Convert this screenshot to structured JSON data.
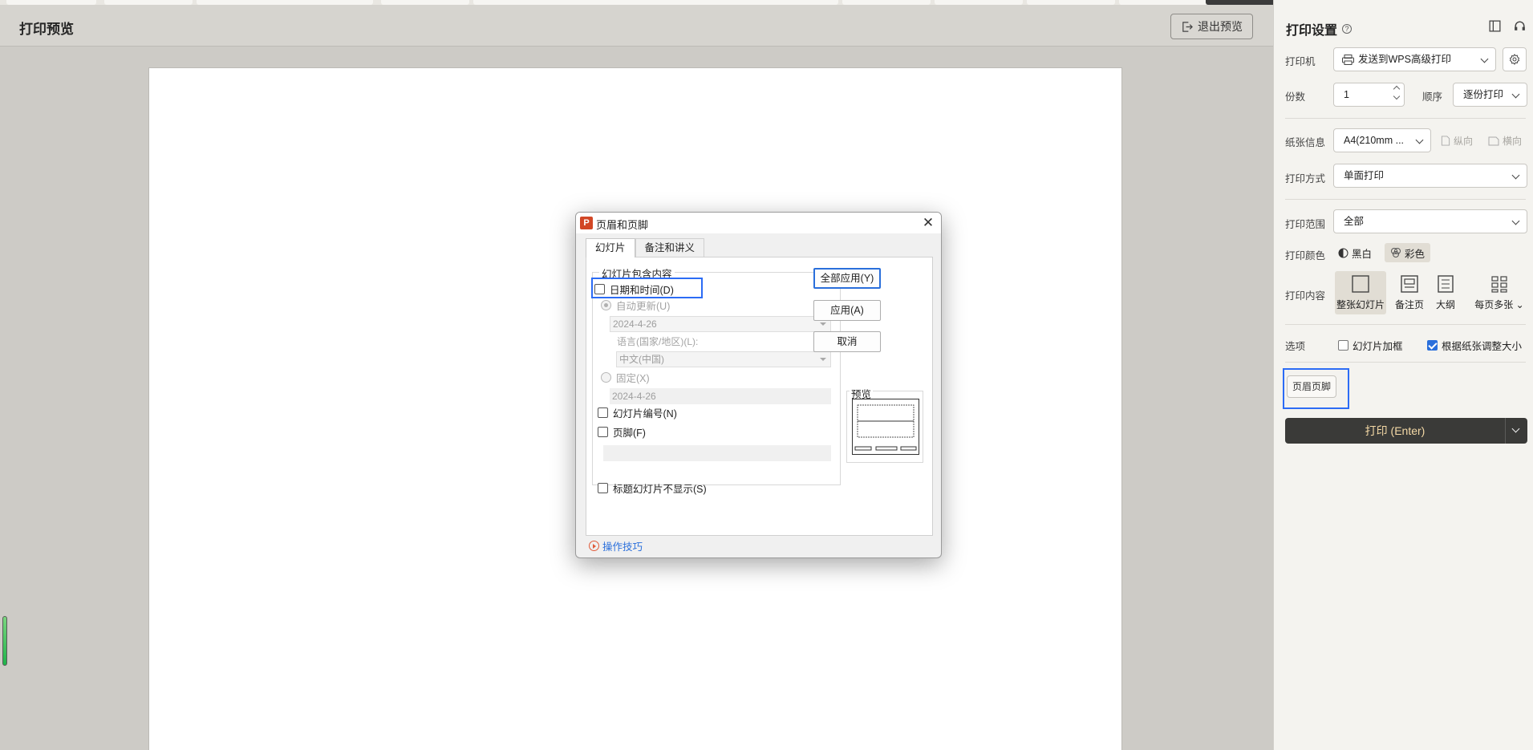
{
  "preview": {
    "title": "打印预览",
    "exit_label": "退出预览"
  },
  "dialog": {
    "title": "页眉和页脚",
    "app_icon": "P",
    "tabs": [
      "幻灯片",
      "备注和讲义"
    ],
    "group_label": "幻灯片包含内容",
    "date_time_label": "日期和时间(D)",
    "auto_update_label": "自动更新(U)",
    "auto_date_value": "2024-4-26",
    "language_label": "语言(国家/地区)(L):",
    "language_value": "中文(中国)",
    "fixed_label": "固定(X)",
    "fixed_date_value": "2024-4-26",
    "slide_number_label": "幻灯片编号(N)",
    "footer_label": "页脚(F)",
    "hide_title_label": "标题幻灯片不显示(S)",
    "apply_all_label": "全部应用(Y)",
    "apply_label": "应用(A)",
    "cancel_label": "取消",
    "preview_label": "预览",
    "tips_label": "操作技巧"
  },
  "panel": {
    "title": "打印设置",
    "printer_label": "打印机",
    "printer_value": "发送到WPS高级打印",
    "copies_label": "份数",
    "copies_value": "1",
    "order_label": "顺序",
    "order_value": "逐份打印",
    "paper_label": "纸张信息",
    "paper_value": "A4(210mm ...",
    "portrait_label": "纵向",
    "landscape_label": "横向",
    "mode_label": "打印方式",
    "mode_value": "单面打印",
    "range_label": "打印范围",
    "range_value": "全部",
    "color_label": "打印颜色",
    "color_bw": "黑白",
    "color_color": "彩色",
    "content_label": "打印内容",
    "content_options": [
      "整张幻灯片",
      "备注页",
      "大纲",
      "每页多张"
    ],
    "options_label": "选项",
    "option_frame": "幻灯片加框",
    "option_fit": "根据纸张调整大小",
    "header_footer_btn": "页眉页脚",
    "print_btn": "打印 (Enter)"
  },
  "colors": {
    "accent_blue": "#2c6cf5",
    "print_button_bg": "#3a3a38",
    "print_button_text": "#f4d9a6",
    "ppt_icon": "#d24726"
  }
}
